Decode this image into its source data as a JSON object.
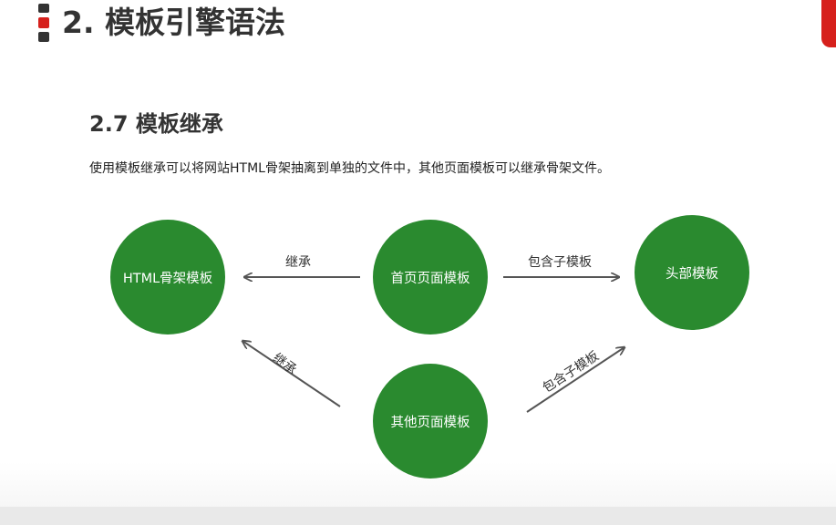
{
  "header": {
    "title": "2. 模板引擎语法"
  },
  "section": {
    "title": "2.7 模板继承",
    "description": "使用模板继承可以将网站HTML骨架抽离到单独的文件中，其他页面模板可以继承骨架文件。"
  },
  "diagram": {
    "nodes": {
      "html_skeleton": "HTML骨架模板",
      "home_page": "首页页面模板",
      "header_template": "头部模板",
      "other_pages": "其他页面模板"
    },
    "edges": {
      "home_to_skeleton": "继承",
      "home_to_header": "包含子模板",
      "other_to_skeleton": "继承",
      "other_to_header": "包含子模板"
    }
  },
  "colors": {
    "node_fill": "#2a8a2f",
    "accent_red": "#d6201c",
    "arrow": "#555555",
    "title_text": "#333333"
  }
}
